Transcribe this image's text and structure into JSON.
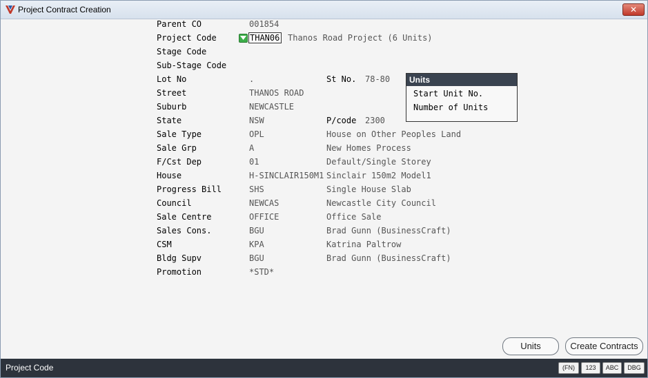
{
  "window": {
    "title": "Project Contract Creation",
    "close_label": "✕"
  },
  "form": {
    "parent_co": {
      "label": "Parent CO",
      "value": "001854"
    },
    "project_code": {
      "label": "Project Code",
      "value": "THAN06",
      "desc": "Thanos Road Project (6 Units)"
    },
    "stage_code": {
      "label": "Stage Code"
    },
    "sub_stage_code": {
      "label": "Sub-Stage Code"
    },
    "lot_no": {
      "label": "Lot No",
      "value": "."
    },
    "st_no": {
      "label": "St No.",
      "value": "78-80"
    },
    "street": {
      "label": "Street",
      "value": "THANOS ROAD"
    },
    "suburb": {
      "label": "Suburb",
      "value": "NEWCASTLE"
    },
    "state": {
      "label": "State",
      "value": "NSW"
    },
    "pcode": {
      "label": "P/code",
      "value": "2300"
    },
    "sale_type": {
      "label": "Sale Type",
      "value": "OPL",
      "desc": "House on Other Peoples Land"
    },
    "sale_grp": {
      "label": "Sale Grp",
      "value": "A",
      "desc": "New Homes Process"
    },
    "fcst_dep": {
      "label": "F/Cst Dep",
      "value": "01",
      "desc": "Default/Single Storey"
    },
    "house": {
      "label": "House",
      "value": "H-SINCLAIR150M1",
      "desc": "Sinclair 150m2 Model1"
    },
    "progress_bill": {
      "label": "Progress Bill",
      "value": "SHS",
      "desc": "Single House Slab"
    },
    "council": {
      "label": "Council",
      "value": "NEWCAS",
      "desc": "Newcastle City Council"
    },
    "sale_centre": {
      "label": "Sale Centre",
      "value": "OFFICE",
      "desc": "Office Sale"
    },
    "sales_cons": {
      "label": "Sales Cons.",
      "value": "BGU",
      "desc": "Brad Gunn (BusinessCraft)"
    },
    "csm": {
      "label": "CSM",
      "value": "KPA",
      "desc": "Katrina Paltrow"
    },
    "bldg_supv": {
      "label": "Bldg Supv",
      "value": "BGU",
      "desc": "Brad Gunn (BusinessCraft)"
    },
    "promotion": {
      "label": "Promotion",
      "value": "*STD*"
    }
  },
  "units_panel": {
    "title": "Units",
    "start_unit_label": "Start Unit No.",
    "number_of_units_label": "Number of Units"
  },
  "buttons": {
    "units": "Units",
    "create_contracts": "Create Contracts"
  },
  "status_bar": {
    "text": "Project Code",
    "badges": [
      "(FN)",
      "123",
      "ABC",
      "DBG"
    ]
  },
  "icons": {
    "app": "app-logo-icon",
    "lookup": "lookup-dropdown-icon",
    "close": "close-icon"
  },
  "colors": {
    "statusbar": "#2d333c",
    "units_header": "#3a4350",
    "lookup": "#3dae4a",
    "close": "#c0392b"
  }
}
